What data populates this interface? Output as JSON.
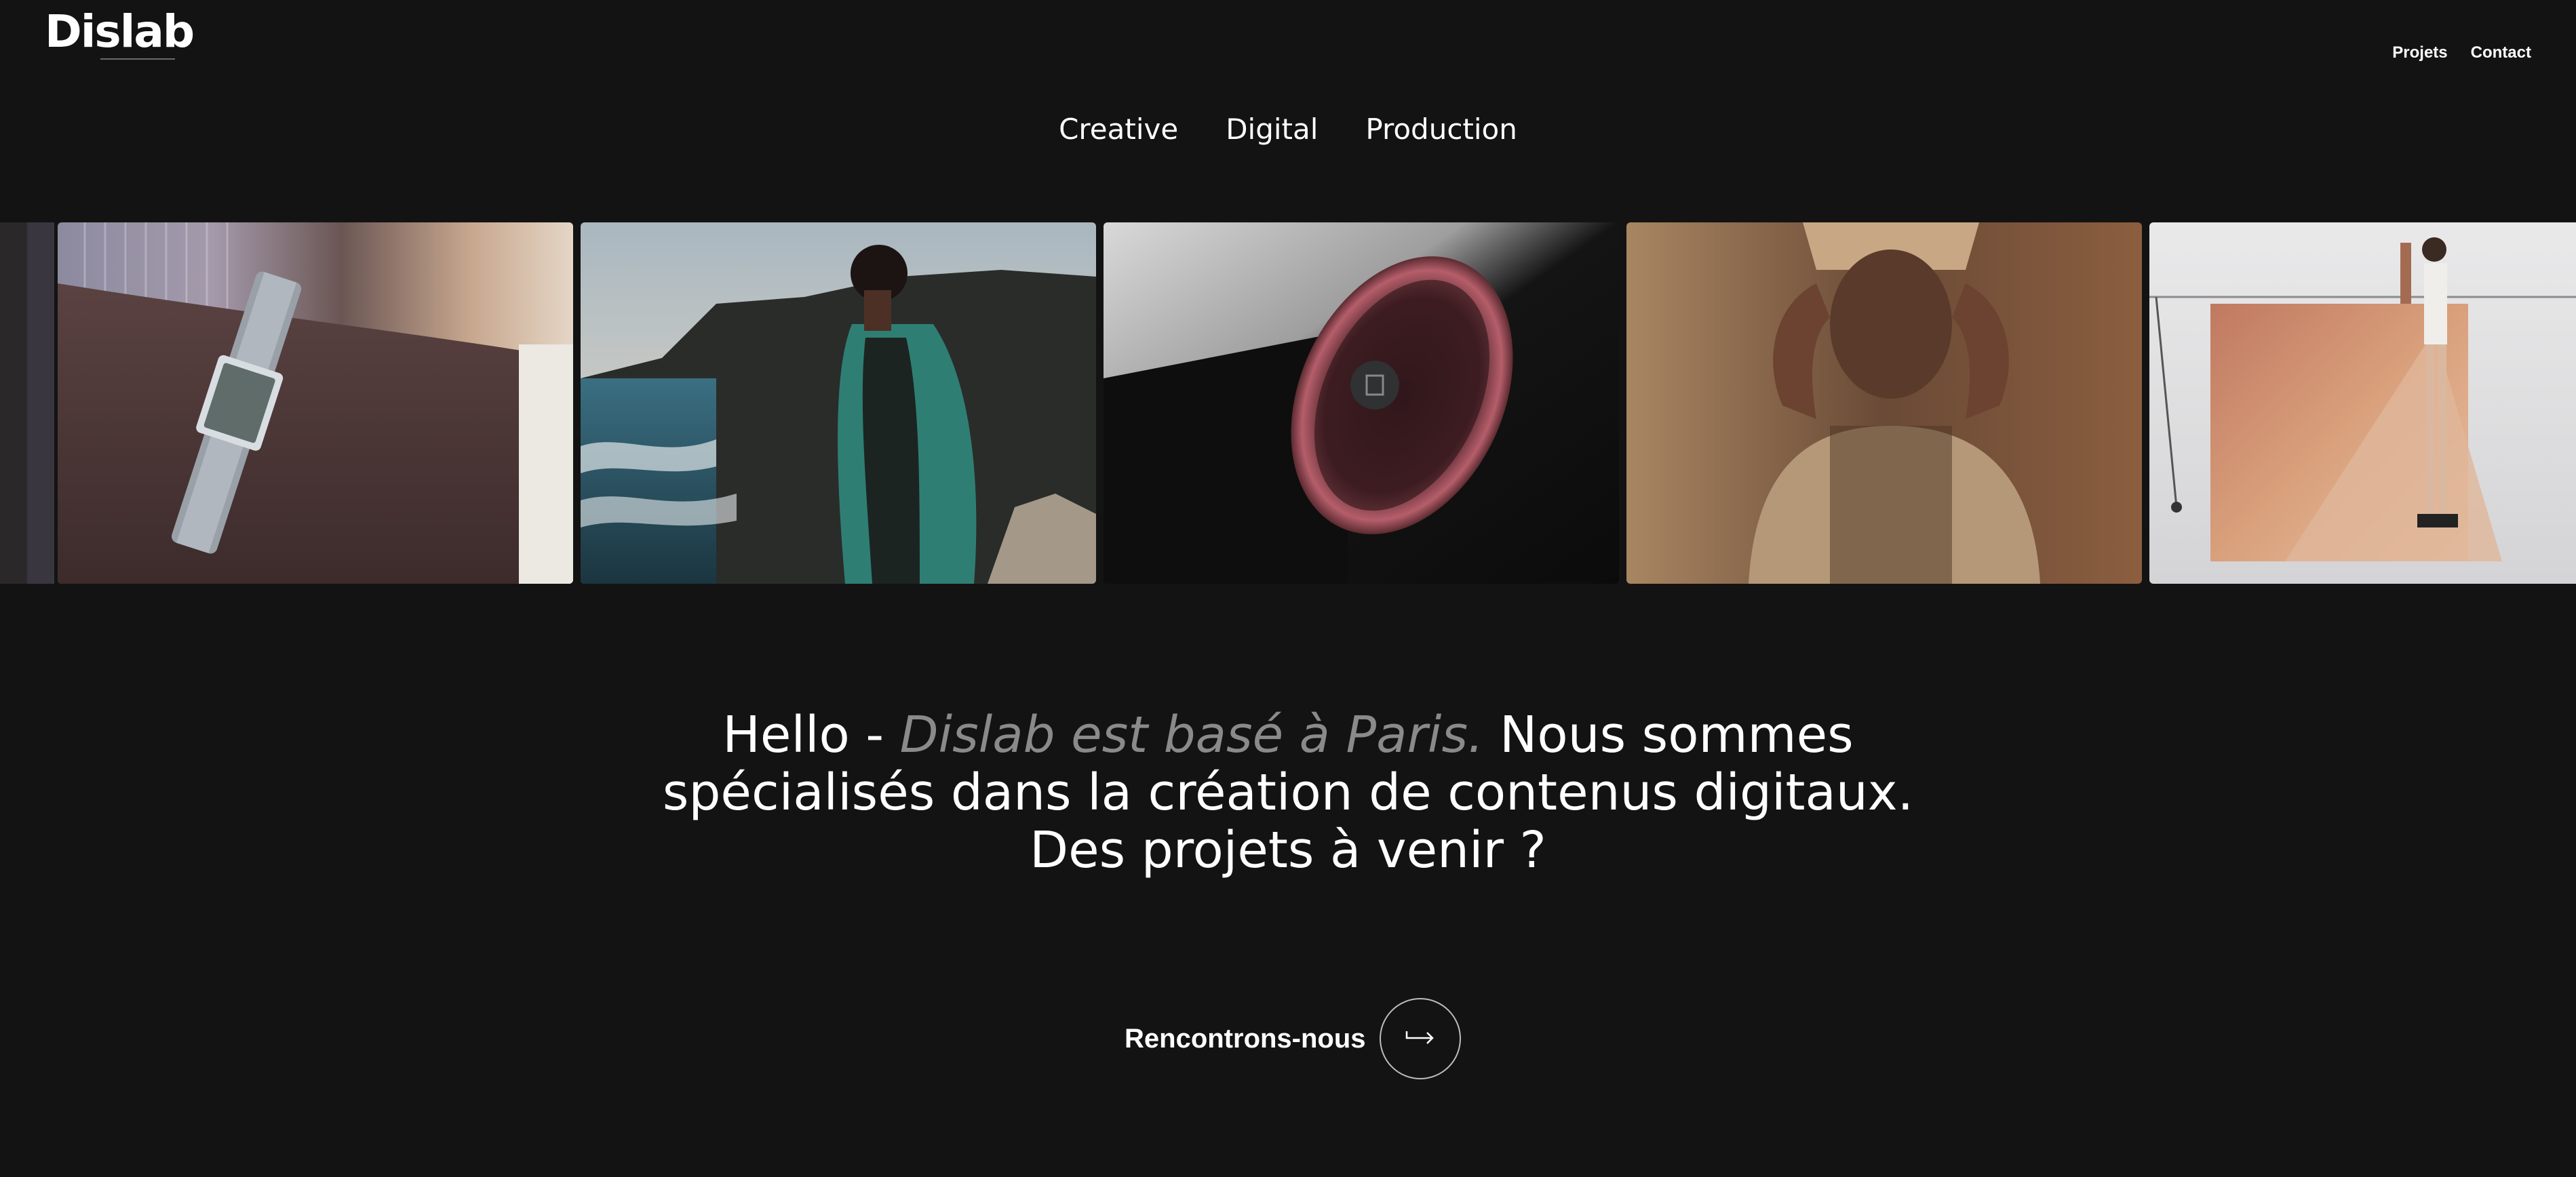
{
  "header": {
    "logo": "Dislab",
    "nav": [
      {
        "label": "Projets"
      },
      {
        "label": "Contact"
      }
    ]
  },
  "categories": [
    "Creative",
    "Digital",
    "Production"
  ],
  "gallery": [
    {
      "subject": "cropped-image"
    },
    {
      "subject": "wrist-watch"
    },
    {
      "subject": "man-by-sea-cliffs"
    },
    {
      "subject": "product-closeup-dark"
    },
    {
      "subject": "woman-hands-portrait"
    },
    {
      "subject": "studio-backdrop-fashion"
    }
  ],
  "intro": {
    "lead": "Hello - ",
    "highlight": "Dislab est basé à Paris.",
    "rest_line1": " Nous sommes",
    "line2": "spécialisés dans la création de contenus digitaux.",
    "line3": "Des projets à venir ?"
  },
  "cta": {
    "label": "Rencontrons-nous",
    "icon": "arrow-right-icon"
  },
  "colors": {
    "background": "#131313",
    "text": "#ffffff",
    "muted": "#8a8a8a"
  }
}
